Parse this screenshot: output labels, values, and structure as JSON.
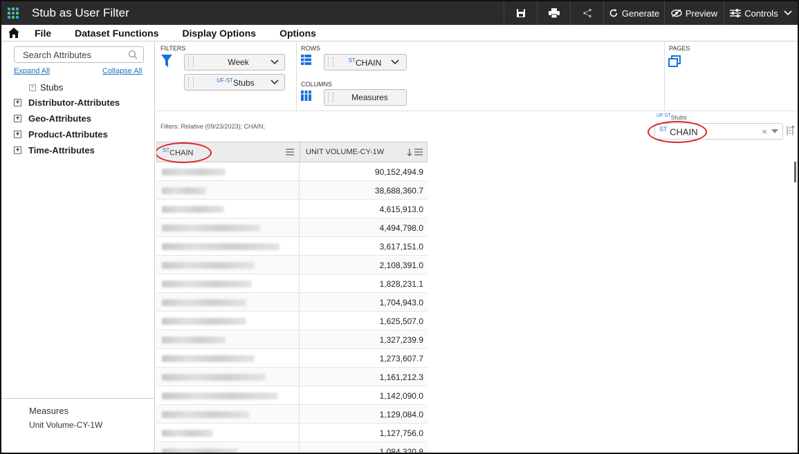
{
  "window": {
    "title": "Stub as User Filter",
    "buttons": {
      "generate": "Generate",
      "preview": "Preview",
      "controls": "Controls"
    }
  },
  "menu": {
    "items": [
      "File",
      "Dataset Functions",
      "Display Options",
      "Options"
    ]
  },
  "left_panel": {
    "search_placeholder": "Search Attributes",
    "expand_all": "Expand All",
    "collapse_all": "Collapse All",
    "tree": [
      {
        "label": "Stubs",
        "bold": false
      },
      {
        "label": "Distributor-Attributes",
        "bold": true
      },
      {
        "label": "Geo-Attributes",
        "bold": true
      },
      {
        "label": "Product-Attributes",
        "bold": true
      },
      {
        "label": "Time-Attributes",
        "bold": true
      }
    ],
    "measures_header": "Measures",
    "measures_item": "Unit Volume-CY-1W"
  },
  "shelves": {
    "filters_label": "FILTERS",
    "filter_pills": [
      {
        "prefix": "",
        "label": "Week"
      },
      {
        "prefix": "UF-ST",
        "label": "Stubs"
      }
    ],
    "rows_label": "ROWS",
    "rows_pill": {
      "prefix": "ST",
      "label": "CHAIN"
    },
    "columns_label": "COLUMNS",
    "columns_pill": "Measures",
    "pages_label": "PAGES"
  },
  "filter_bar": {
    "text": "Filters: Relative (09/23/2023); CHAIN;",
    "user_filter_caption_prefix": "UF-ST",
    "user_filter_caption": "Stubs",
    "user_filter_prefix": "ST",
    "user_filter_value": "CHAIN"
  },
  "table": {
    "col1_prefix": "ST",
    "col1": "CHAIN",
    "col2": "UNIT VOLUME-CY-1W",
    "values": [
      "90,152,494.9",
      "38,688,360.7",
      "4,615,913.0",
      "4,494,798.0",
      "3,617,151.0",
      "2,108,391.0",
      "1,828,231.1",
      "1,704,943.0",
      "1,625,507.0",
      "1,327,239.9",
      "1,273,607.7",
      "1,161,212.3",
      "1,142,090.0",
      "1,129,084.0",
      "1,127,756.0",
      "1,084,320.8"
    ]
  },
  "colors": {
    "titlebar": "#2b2b2b",
    "accent_blue": "#1a73d9",
    "annotation_red": "#dd2222"
  }
}
